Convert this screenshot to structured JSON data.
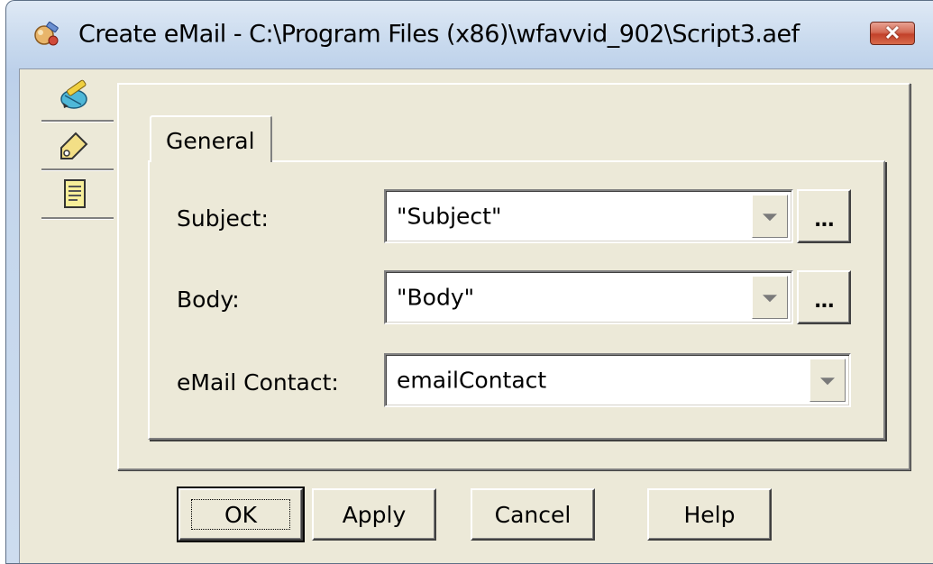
{
  "window": {
    "title": "Create eMail - C:\\Program Files (x86)\\wfavvid_902\\Script3.aef",
    "app_icon": "script-editor-icon",
    "close_icon": "close-icon"
  },
  "icon_strip": {
    "items": [
      {
        "icon": "wizard-pencil-icon"
      },
      {
        "icon": "tag-label-icon"
      },
      {
        "icon": "document-icon"
      }
    ]
  },
  "tabs": [
    {
      "label": "General",
      "selected": true
    }
  ],
  "form": {
    "subject": {
      "label": "Subject:",
      "value": "\"Subject\""
    },
    "body": {
      "label": "Body:",
      "value": "\"Body\""
    },
    "email_contact": {
      "label": "eMail Contact:",
      "value": "emailContact"
    },
    "ellipsis_label": "..."
  },
  "buttons": {
    "ok": "OK",
    "apply": "Apply",
    "cancel": "Cancel",
    "help": "Help"
  },
  "colors": {
    "dialog_face": "#ece9d8",
    "title_bar": "#c9daee",
    "close_button": "#c2412a"
  }
}
